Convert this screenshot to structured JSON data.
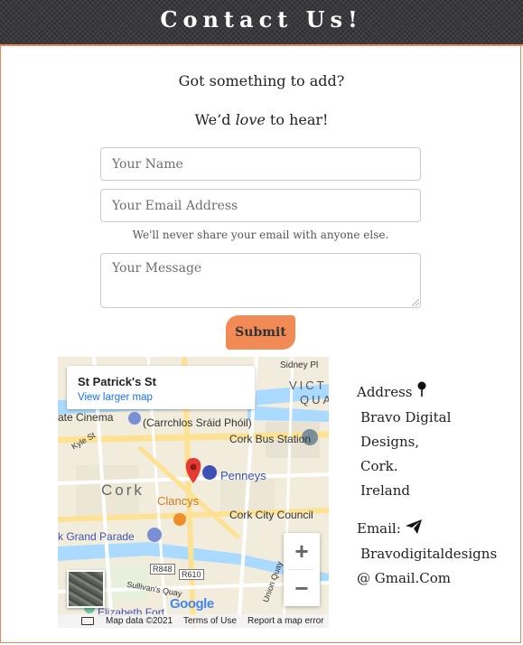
{
  "header": {
    "title": "Contact Us!"
  },
  "intro": {
    "line1": "Got something to add?",
    "line2_pre": "We’d",
    "line2_em": "love",
    "line2_post": "to hear!"
  },
  "form": {
    "name_placeholder": "Your Name",
    "email_placeholder": "Your Email Address",
    "email_help": "We'll never share your email with anyone else.",
    "message_placeholder": "Your Message",
    "submit_label": "Submit"
  },
  "map": {
    "place_title": "St Patrick's St",
    "view_larger": "View larger map",
    "labels": {
      "sidney": "Sidney Pl",
      "victoria": "VICT",
      "quay": "QUA",
      "cinema": "ate Cinema",
      "carrchlos": "(Carrchlos Sráid Phóil)",
      "bus": "Cork Bus Station",
      "kyle": "Kyle St",
      "penneys": "Penneys",
      "cork": "Cork",
      "clancys": "Clancys",
      "council": "Cork City Council",
      "grand_parade": "k Grand Parade",
      "r848": "R848",
      "r610": "R610",
      "sullivans": "Sullivan's Quay",
      "union": "Union Quay",
      "elizabeth": "Elizabeth Fort",
      "google": "Google"
    },
    "zoom_in": "+",
    "zoom_out": "−",
    "attribution": {
      "data": "Map data ©2021",
      "terms": "Terms of Use",
      "report": "Report a map error"
    },
    "colors": {
      "pin": "#e53935",
      "water": "#aadaff",
      "road": "#fde293",
      "park": "#c8e6c9"
    }
  },
  "contact": {
    "address_label": "Address",
    "address_lines": [
      "Bravo Digital",
      "Designs,",
      "Cork.",
      "Ireland"
    ],
    "email_label": "Email:",
    "email_lines": [
      "Bravodigitaldesigns",
      "@ Gmail.Com"
    ],
    "icons": {
      "address": "map-pin-icon",
      "email": "paper-plane-icon"
    }
  },
  "colors": {
    "accent": "#f28a55",
    "header_bg": "#2f2f33",
    "border": "#e8875a"
  }
}
